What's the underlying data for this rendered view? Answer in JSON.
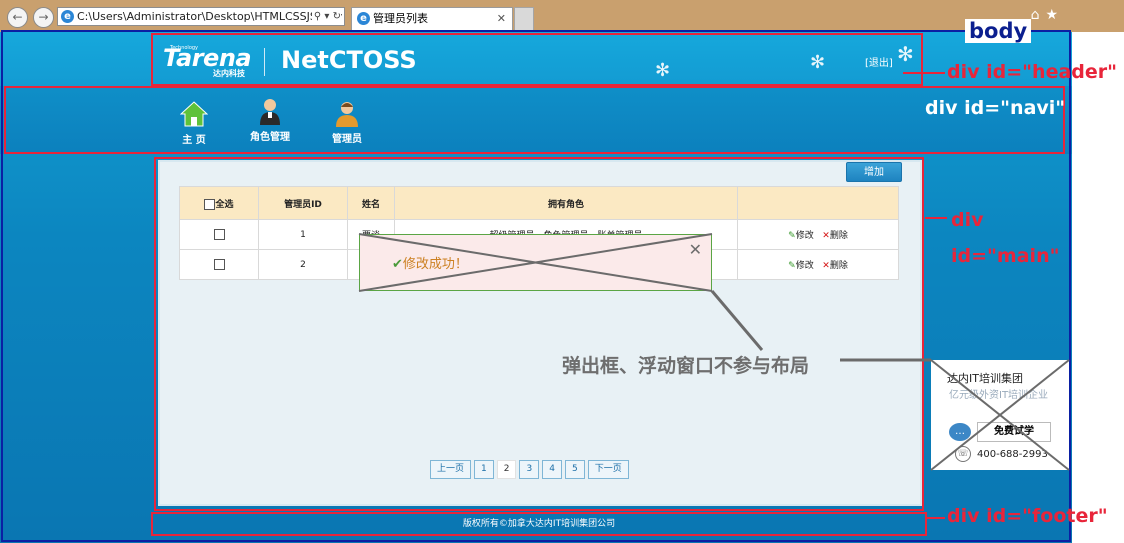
{
  "browser": {
    "address": "C:\\Users\\Administrator\\Desktop\\HTMLCSSJS\\Day",
    "tab_title": "管理员列表",
    "back_icon": "back-arrow-icon",
    "forward_icon": "forward-arrow-icon"
  },
  "header": {
    "logo": "Tarena",
    "logo_cn": "达内科技",
    "logo_tech": "Technology",
    "app_name": "NetCTOSS",
    "logout": "[退出]"
  },
  "navi": {
    "items": [
      {
        "label": "主  页",
        "icon": "home-icon"
      },
      {
        "label": "角色管理",
        "icon": "role-icon"
      },
      {
        "label": "管理员",
        "icon": "admin-icon"
      }
    ]
  },
  "main": {
    "add_button": "增加",
    "table": {
      "headers": [
        "全选",
        "管理员ID",
        "姓名",
        "拥有角色",
        ""
      ],
      "rows": [
        {
          "id": "1",
          "name": "贾谈",
          "roles": "超级管理员、角色管理员、账单管理员",
          "edit": "修改",
          "delete": "删除"
        },
        {
          "id": "2",
          "name": "贾",
          "roles": "",
          "edit": "修改",
          "delete": "删除"
        }
      ]
    },
    "toast": {
      "message": "修改成功！"
    },
    "pager": [
      "上一页",
      "1",
      "2",
      "3",
      "4",
      "5",
      "下一页"
    ],
    "current_page": "2"
  },
  "footer": {
    "text": "版权所有©加拿大达内IT培训集团公司"
  },
  "ad": {
    "title": "达内IT培训集团",
    "subtitle": "亿元级外资IT培训企业",
    "try_button": "免费试学",
    "phone": "400-688-2993"
  },
  "annotations": {
    "body": "body",
    "header": "div id=\"header\"",
    "navi": "div id=\"navi\"",
    "main_line1": "div",
    "main_line2": "id=\"main\"",
    "footer": "div id=\"footer\"",
    "callout": "弹出框、浮动窗口不参与布局"
  },
  "colors": {
    "annotation_red": "#e8253a",
    "body_blue": "#0b1fa3",
    "page_blue": "#0c86c0"
  }
}
